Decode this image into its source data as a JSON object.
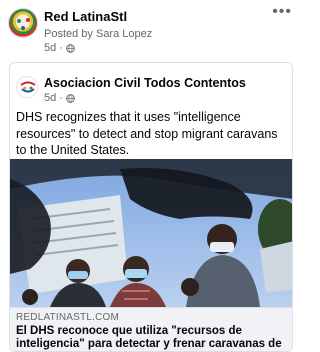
{
  "post": {
    "page_name": "Red LatinaStl",
    "posted_by": "Posted by Sara Lopez",
    "time": "5d",
    "privacy_icon": "globe-icon",
    "more_icon": "more-options-icon"
  },
  "shared_post": {
    "page_name": "Asociacion Civil Todos Contentos",
    "time": "5d",
    "privacy_icon": "globe-icon",
    "text": "DHS recognizes that it uses \"intelligence resources\" to detect and stop migrant caravans to the United States."
  },
  "link_preview": {
    "domain": "REDLATINASTL.COM",
    "title": "El DHS reconoce que utiliza \"recursos de inteligencia\" para detectar y frenar caravanas de migrantes a EEUU"
  },
  "colors": {
    "text_primary": "#050505",
    "text_secondary": "#65676b",
    "footer_bg": "#f0f2f5",
    "sky": "#8fb4e8"
  }
}
